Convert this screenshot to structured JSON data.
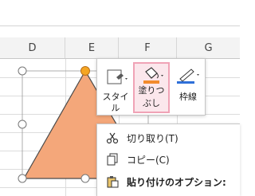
{
  "columns": [
    "D",
    "E",
    "F",
    "G"
  ],
  "mini_toolbar": {
    "style_label": "スタイル",
    "fill_label_line1": "塗りつ",
    "fill_label_line2": "ぶし",
    "outline_label": "枠線"
  },
  "context_menu": {
    "items": [
      {
        "label": "切り取り(T)",
        "icon": "scissors-icon"
      },
      {
        "label": "コピー(C)",
        "icon": "copy-icon"
      },
      {
        "label": "貼り付けのオプション:",
        "icon": "paste-icon"
      }
    ]
  },
  "colors": {
    "shape_fill": "#f4a77a",
    "shape_outline": "#4a4a4a",
    "fill_highlight_border": "#f0a3b6",
    "accent_line": "#f28b2d",
    "pen_blue": "#2e6fd8"
  }
}
